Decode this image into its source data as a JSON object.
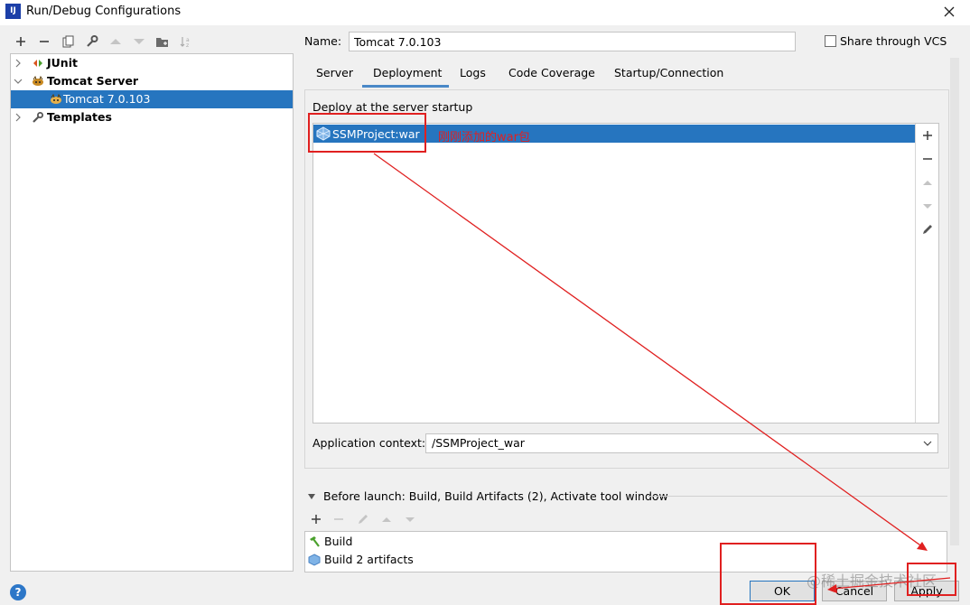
{
  "window": {
    "title": "Run/Debug Configurations",
    "app_icon_text": "IJ"
  },
  "toolbar": {
    "icons": [
      "add-icon",
      "remove-icon",
      "copy-icon",
      "wrench-icon",
      "move-up-icon",
      "move-down-icon",
      "new-folder-icon",
      "sort-icon"
    ]
  },
  "tree": {
    "items": [
      {
        "label": "JUnit",
        "expanded": false
      },
      {
        "label": "Tomcat Server",
        "expanded": true
      },
      {
        "label": "Tomcat 7.0.103",
        "selected": true
      },
      {
        "label": "Templates",
        "expanded": false
      }
    ]
  },
  "form": {
    "name_label": "Name:",
    "name_value": "Tomcat 7.0.103",
    "share_label": "Share through VCS",
    "share_checked": false
  },
  "tabs": [
    {
      "label": "Server"
    },
    {
      "label": "Deployment",
      "active": true
    },
    {
      "label": "Logs"
    },
    {
      "label": "Code Coverage"
    },
    {
      "label": "Startup/Connection"
    }
  ],
  "deployment": {
    "section_label": "Deploy at the server startup",
    "items": [
      {
        "label": "SSMProject:war"
      }
    ],
    "annotation": "刚刚添加的war包",
    "context_label": "Application context:",
    "context_value": "/SSMProject_war"
  },
  "before_launch": {
    "label": "Before launch: Build, Build Artifacts (2), Activate tool window",
    "items": [
      {
        "label": "Build"
      },
      {
        "label": "Build 2 artifacts"
      }
    ]
  },
  "buttons": {
    "ok": "OK",
    "cancel": "Cancel",
    "apply": "Apply",
    "help": "?"
  },
  "watermark": "@稀土掘金技术社区",
  "colors": {
    "selection": "#2675bf",
    "annotation": "#e02020",
    "tab_underline": "#4a88c7"
  }
}
